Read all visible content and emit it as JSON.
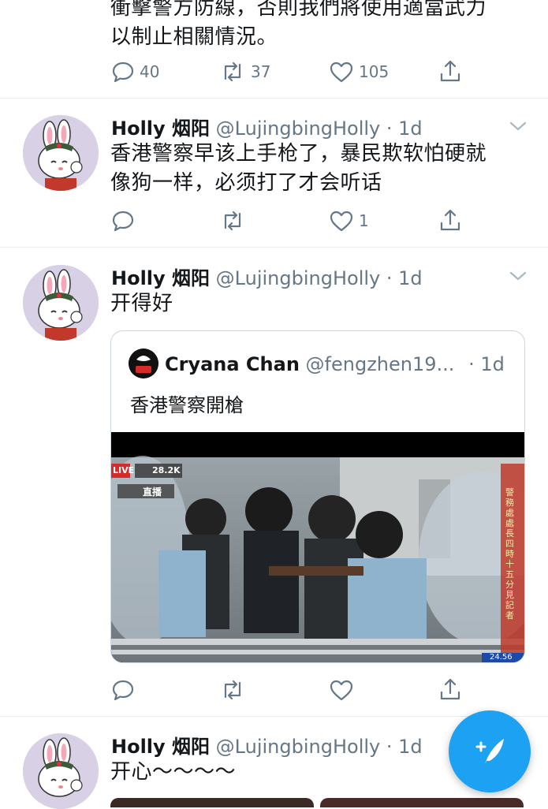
{
  "tweet0": {
    "text_line1": "衝擊警方防線，否則我們將使用適當武力",
    "text_line2": "以制止相關情況。",
    "replies": "40",
    "retweets": "37",
    "likes": "105"
  },
  "tweet1": {
    "name": "Holly 烟阳",
    "handle": "@LujingbingHolly",
    "time": "· 1d",
    "text_line1": "香港警察早该上手枪了，暴民欺软怕硬就",
    "text_line2": "像狗一样，必须打了才会听话",
    "replies": "",
    "retweets": "",
    "likes": "1"
  },
  "tweet2": {
    "name": "Holly 烟阳",
    "handle": "@LujingbingHolly",
    "time": "· 1d",
    "text": "开得好",
    "quote": {
      "name": "Cryana Chan",
      "handle": "@fengzhen19...",
      "time": "· 1d",
      "text": "香港警察開槍",
      "media": {
        "live_badge": "LIVE",
        "viewers": "28.2K",
        "broadcast_tag": "直播",
        "side_caption": "警務處處長四時十五分見記者",
        "corner_text": "24.56"
      }
    }
  },
  "tweet3": {
    "name": "Holly 烟阳",
    "handle": "@LujingbingHolly",
    "time": "· 1d",
    "text": "开心～～～～"
  },
  "icons": {
    "reply": "reply-icon",
    "retweet": "retweet-icon",
    "like": "heart-icon",
    "share": "share-icon",
    "more": "chevron-down-icon",
    "compose": "compose-tweet-icon"
  },
  "colors": {
    "accent": "#1da1f2",
    "secondary_text": "#657786",
    "divider": "#e6ecf0"
  }
}
